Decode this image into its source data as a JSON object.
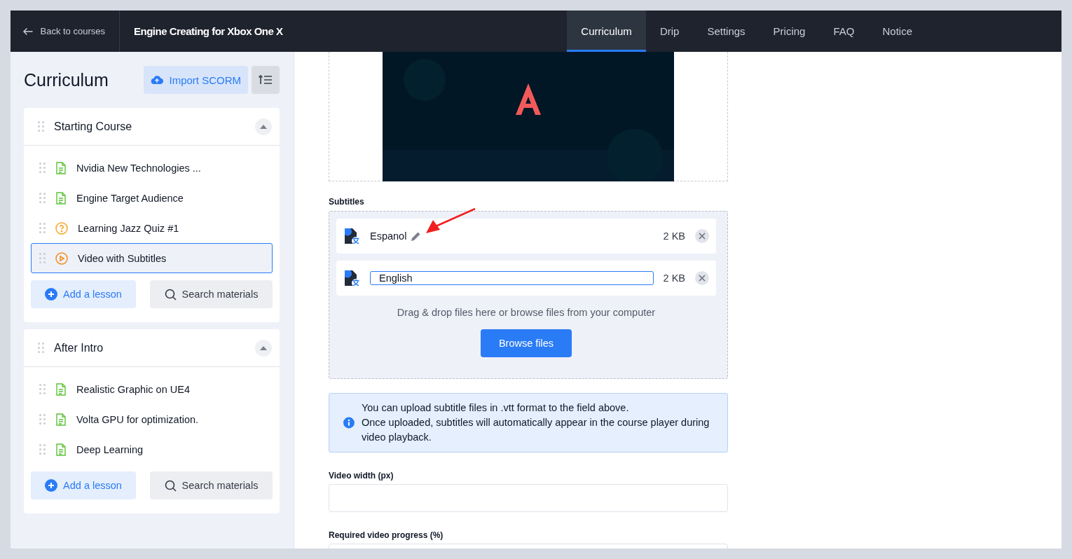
{
  "topbar": {
    "back_link": "Back to courses",
    "course_title": "Engine Creating for Xbox One X",
    "tabs": [
      {
        "label": "Curriculum",
        "selected": true
      },
      {
        "label": "Drip",
        "selected": false
      },
      {
        "label": "Settings",
        "selected": false
      },
      {
        "label": "Pricing",
        "selected": false
      },
      {
        "label": "FAQ",
        "selected": false
      },
      {
        "label": "Notice",
        "selected": false
      }
    ]
  },
  "sidebar": {
    "title": "Curriculum",
    "import_button": "Import SCORM",
    "sections": [
      {
        "title": "Starting Course",
        "expanded": true,
        "add_button": "Add a lesson",
        "search_button": "Search materials",
        "lessons": [
          {
            "title": "Nvidia New Technologies ...",
            "kind": "text",
            "selected": false
          },
          {
            "title": "Engine Target Audience",
            "kind": "text",
            "selected": false
          },
          {
            "title": "Learning Jazz Quiz #1",
            "kind": "quiz",
            "selected": false
          },
          {
            "title": "Video with Subtitles",
            "kind": "video",
            "selected": true
          }
        ]
      },
      {
        "title": "After Intro",
        "expanded": true,
        "add_button": "Add a lesson",
        "search_button": "Search materials",
        "lessons": [
          {
            "title": "Realistic Graphic on UE4",
            "kind": "text",
            "selected": false
          },
          {
            "title": "Volta GPU for optimization.",
            "kind": "text",
            "selected": false
          },
          {
            "title": "Deep Learning",
            "kind": "text",
            "selected": false
          }
        ]
      }
    ]
  },
  "content": {
    "subtitles_label": "Subtitles",
    "files": [
      {
        "name": "Espanol",
        "size": "2 KB",
        "editing": false
      },
      {
        "name": "English",
        "size": "2 KB",
        "editing": true
      }
    ],
    "drop_hint": "Drag & drop files here or browse files from your computer",
    "browse_button": "Browse files",
    "info_lines": [
      "You can upload subtitle files in .vtt format to the field above.",
      "Once uploaded, subtitles will automatically appear in the course player during video playback."
    ],
    "fields": [
      {
        "label": "Video width (px)"
      },
      {
        "label": "Required video progress (%)"
      }
    ]
  }
}
